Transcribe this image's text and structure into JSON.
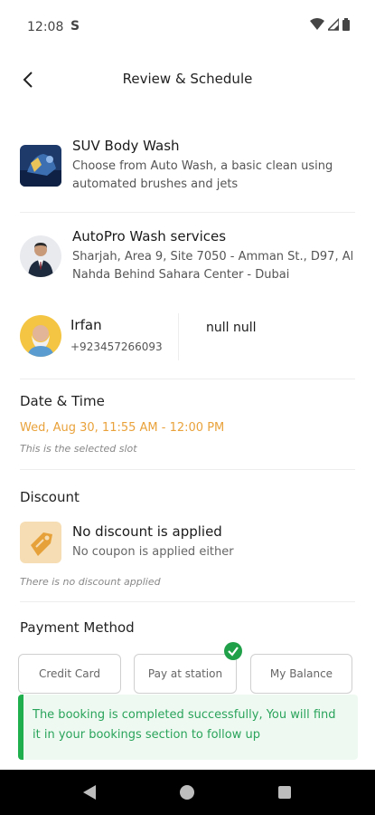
{
  "status_bar": {
    "time": "12:08",
    "s_icon": "S"
  },
  "header": {
    "title": "Review & Schedule"
  },
  "service": {
    "title": "SUV Body Wash",
    "description": "Choose from Auto Wash, a basic clean using automated brushes and jets"
  },
  "provider": {
    "name": "AutoPro Wash services",
    "address": "Sharjah, Area 9, Site 7050 - Amman St., D97, Al Nahda Behind Sahara Center - Dubai"
  },
  "customer": {
    "name": "Irfan",
    "phone": "+923457266093",
    "secondary": "null null"
  },
  "date_time": {
    "section_title": "Date & Time",
    "slot": "Wed, Aug 30, 11:55 AM - 12:00 PM",
    "note": "This is the selected slot"
  },
  "discount": {
    "section_title": "Discount",
    "title": "No discount is applied",
    "subtitle": "No coupon is applied either",
    "note": "There is no discount applied"
  },
  "payment": {
    "section_title": "Payment Method",
    "options": [
      {
        "label": "Credit Card"
      },
      {
        "label": "Pay at station",
        "selected": true
      },
      {
        "label": "My Balance"
      }
    ]
  },
  "toast": {
    "message": "The booking is completed successfully, You will find it in your bookings section to follow up"
  },
  "colors": {
    "accent_orange": "#e9a23b",
    "success_green": "#1fb04d"
  }
}
